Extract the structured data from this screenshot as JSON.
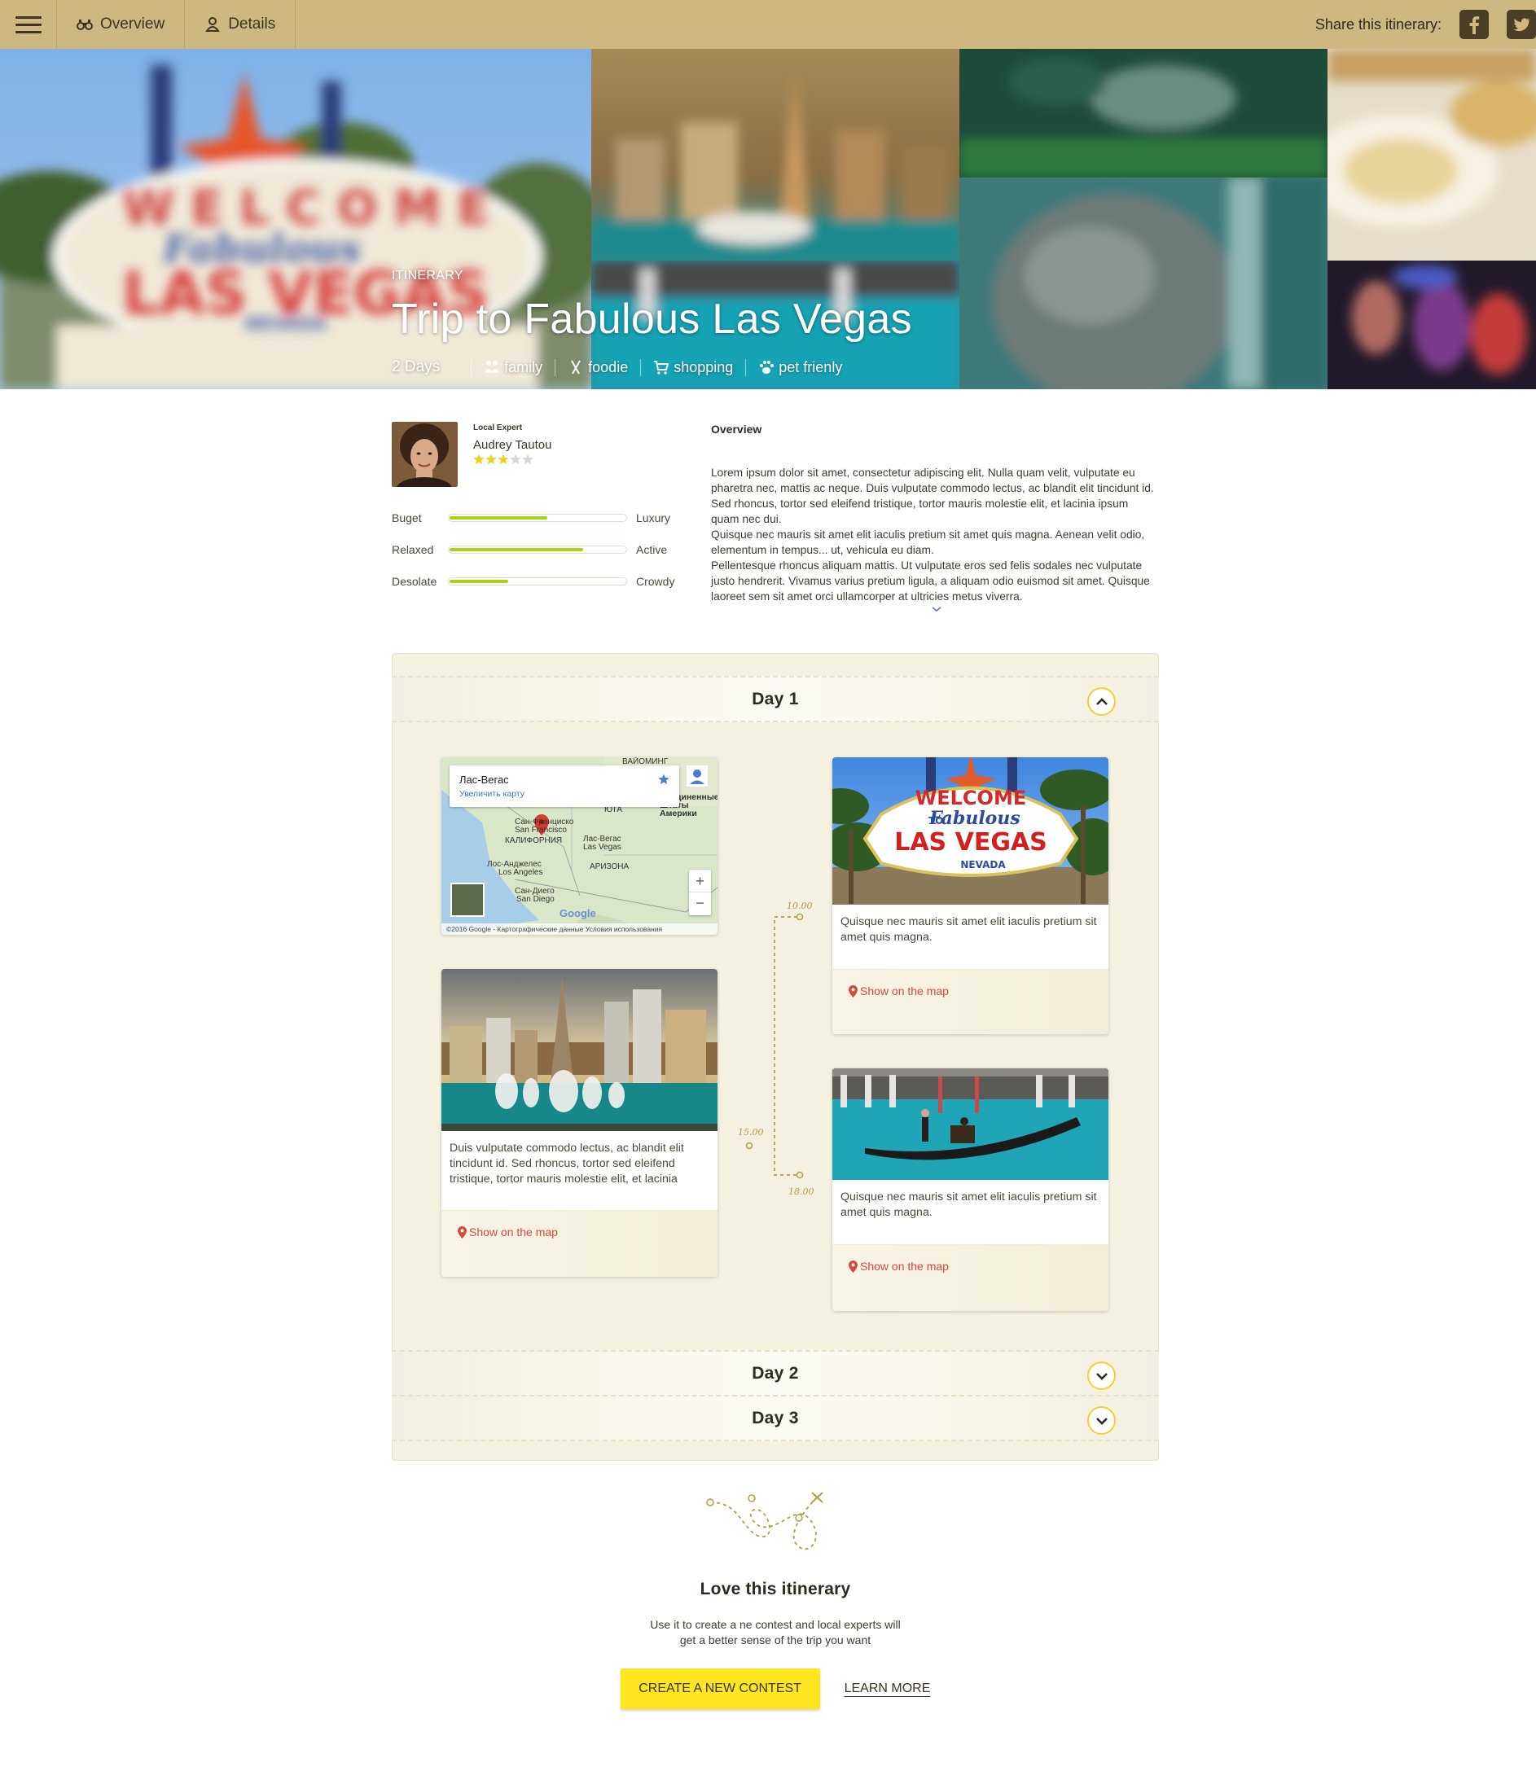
{
  "nav": {
    "menu_icon": "hamburger-menu-icon",
    "tabs": [
      {
        "label": "Overview",
        "icon": "binoculars-icon"
      },
      {
        "label": "Details",
        "icon": "person-pin-icon"
      }
    ],
    "share_label": "Share this itinerary:",
    "social": [
      {
        "name": "facebook",
        "icon": "facebook-icon"
      },
      {
        "name": "twitter",
        "icon": "twitter-icon"
      }
    ]
  },
  "hero": {
    "kicker": "ITINERARY",
    "title": "Trip to Fabulous Las Vegas",
    "duration": "2 Days",
    "tags": [
      {
        "label": "family",
        "icon": "family-icon"
      },
      {
        "label": "foodie",
        "icon": "cutlery-icon"
      },
      {
        "label": "shopping",
        "icon": "cart-icon"
      },
      {
        "label": "pet frienly",
        "icon": "paw-icon"
      }
    ]
  },
  "expert": {
    "kicker": "Local Expert",
    "name": "Audrey Tautou",
    "rating": 3,
    "rating_max": 5,
    "scales": [
      {
        "low": "Buget",
        "high": "Luxury",
        "level": 0.55
      },
      {
        "low": "Relaxed",
        "high": "Active",
        "level": 0.75
      },
      {
        "low": "Desolate",
        "high": "Crowdy",
        "level": 0.33
      }
    ]
  },
  "overview": {
    "heading": "Overview",
    "paragraphs": [
      "Lorem ipsum dolor sit amet, consectetur adipiscing elit. Nulla quam velit, vulputate eu pharetra nec, mattis ac neque. Duis vulputate commodo lectus, ac blandit elit tincidunt id. Sed rhoncus, tortor sed eleifend tristique, tortor mauris molestie elit, et lacinia ipsum quam nec dui.",
      "Quisque nec mauris sit amet elit iaculis pretium sit amet quis magna. Aenean velit odio, elementum in tempus... ut, vehicula eu diam.",
      "Pellentesque rhoncus aliquam mattis. Ut vulputate eros sed felis sodales nec vulputate justo hendrerit. Vivamus varius pretium ligula, a aliquam odio euismod sit amet. Quisque laoreet sem sit amet orci ullamcorper at ultricies metus viverra."
    ]
  },
  "days": [
    {
      "title": "Day 1",
      "state": "expanded"
    },
    {
      "title": "Day 2",
      "state": "collapsed"
    },
    {
      "title": "Day 3",
      "state": "collapsed"
    }
  ],
  "map": {
    "place": "Лас-Вегас",
    "enlarge": "Увеличить карту",
    "labels": {
      "wyoming": "ВАЙОМИНГ",
      "utah": "ЮТА",
      "usa": "Соединенные Штаты Америки",
      "sf": "Сан-Франциско",
      "sf_en": "San Francisco",
      "ca": "КАЛИФОРНИЯ",
      "lv": "Лас-Вегас",
      "lv_en": "Las Vegas",
      "la": "Лос-Анджелес",
      "la_en": "Los Angeles",
      "az": "АРИЗОНА",
      "sd": "Сан-Диего",
      "sd_en": "San Diego"
    },
    "zoom_in": "+",
    "zoom_out": "−",
    "google": "Google",
    "footer": "©2016 Google - Картографические данные   Условия использования"
  },
  "times": [
    "10.00",
    "15.00",
    "18.00"
  ],
  "cards": [
    {
      "text": "Quisque nec mauris sit amet elit iaculis pretium sit amet quis magna.",
      "link": "Show on the map"
    },
    {
      "text": "Duis vulputate commodo lectus, ac blandit elit tincidunt id. Sed rhoncus, tortor sed eleifend tristique, tortor mauris molestie elit, et lacinia",
      "link": "Show on the map"
    },
    {
      "text": "Quisque nec mauris sit amet elit iaculis pretium sit amet quis magna.",
      "link": "Show on the map"
    }
  ],
  "sign": {
    "welcome": "WELCOME",
    "to": "TO",
    "fabulous": "Fabulous",
    "city": "LAS VEGAS",
    "state": "NEVADA"
  },
  "cta": {
    "title": "Love this itinerary",
    "text": "Use it to create a ne contest and local experts will get a better sense of the trip you want",
    "primary": "CREATE A NEW CONTEST",
    "secondary": "LEARN MORE"
  },
  "colors": {
    "topbar": "#cfb782",
    "accent": "#fde51f",
    "slider": "#a8d416",
    "link": "#d9473c",
    "panel": "#f5f1e1"
  }
}
